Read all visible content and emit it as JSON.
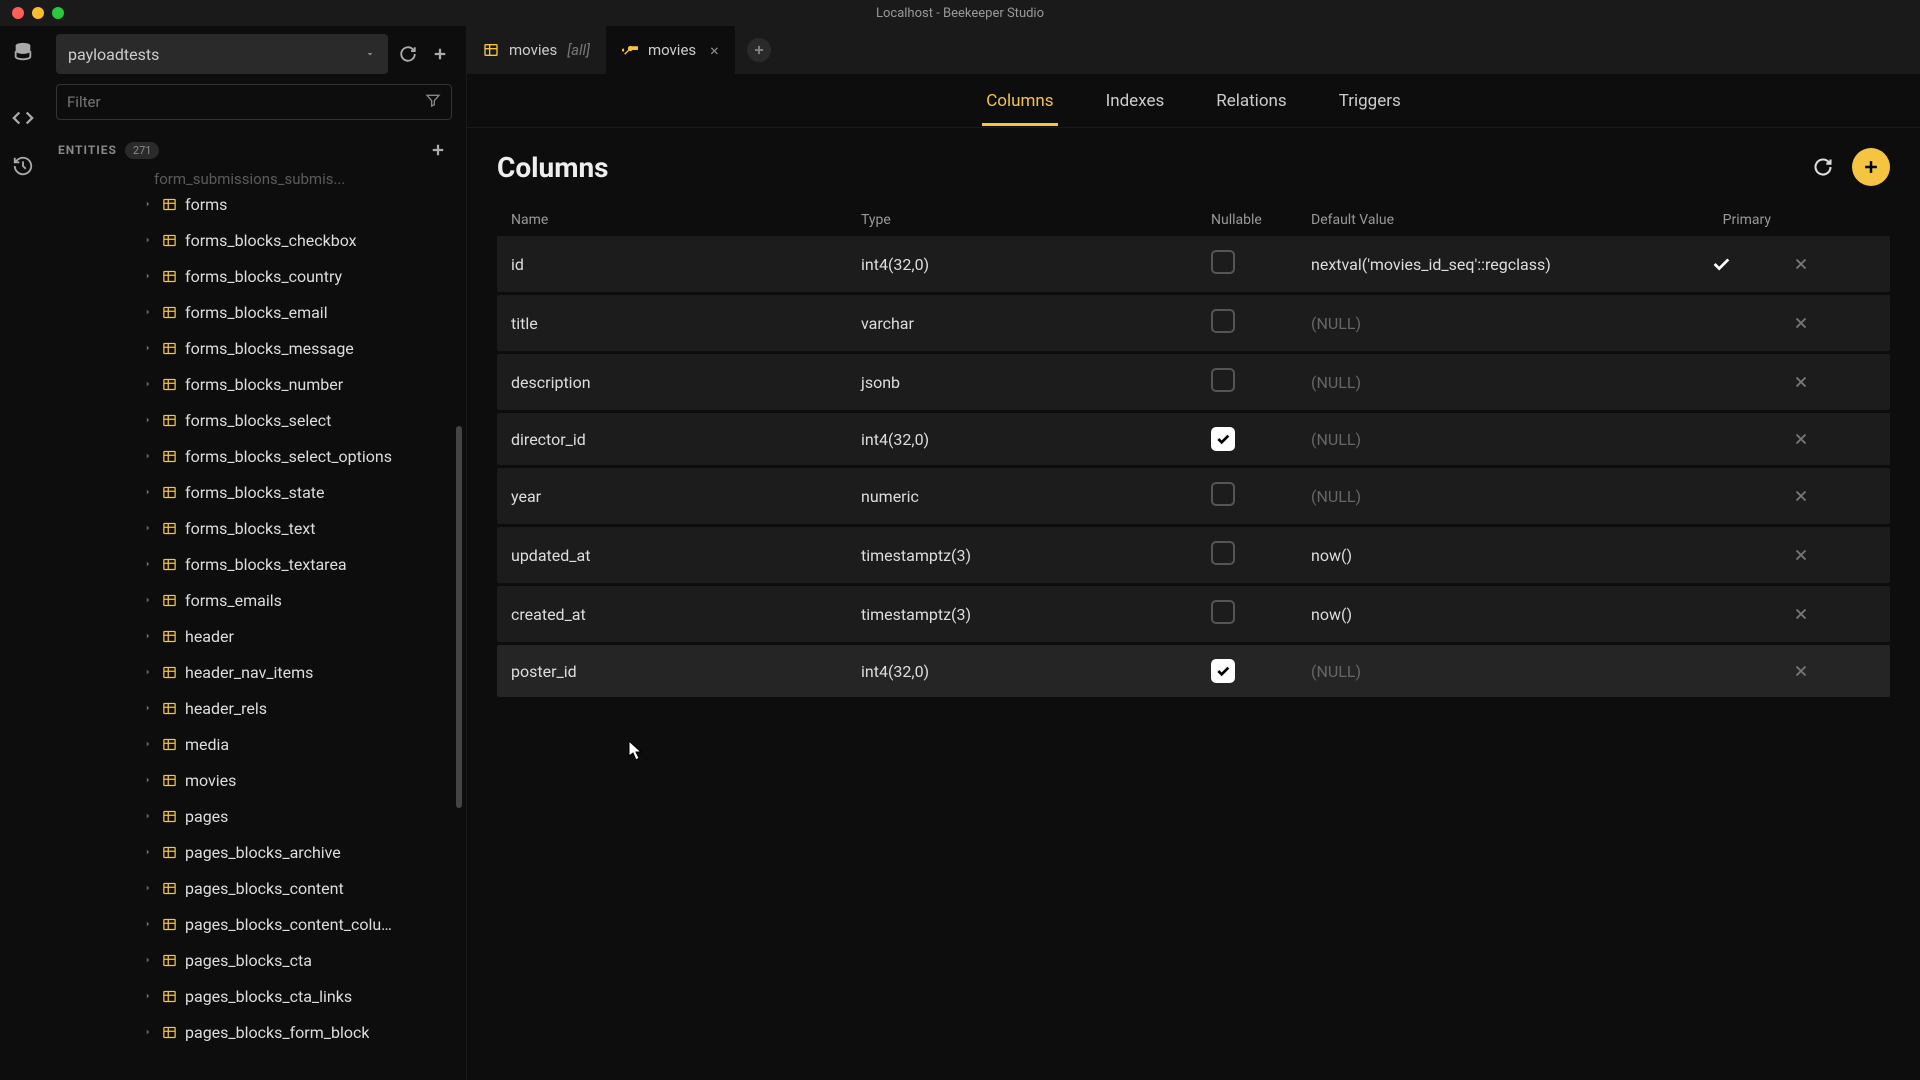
{
  "window": {
    "title": "Localhost - Beekeeper Studio"
  },
  "sidebar": {
    "db_name": "payloadtests",
    "filter_placeholder": "Filter",
    "entities_label": "ENTITIES",
    "entities_count": "271",
    "cutoff_item": "form_submissions_submis...",
    "items": [
      "forms",
      "forms_blocks_checkbox",
      "forms_blocks_country",
      "forms_blocks_email",
      "forms_blocks_message",
      "forms_blocks_number",
      "forms_blocks_select",
      "forms_blocks_select_options",
      "forms_blocks_state",
      "forms_blocks_text",
      "forms_blocks_textarea",
      "forms_emails",
      "header",
      "header_nav_items",
      "header_rels",
      "media",
      "movies",
      "pages",
      "pages_blocks_archive",
      "pages_blocks_content",
      "pages_blocks_content_colu…",
      "pages_blocks_cta",
      "pages_blocks_cta_links",
      "pages_blocks_form_block"
    ]
  },
  "tabs": [
    {
      "label": "movies",
      "suffix": "[all]",
      "icon": "table",
      "active": false
    },
    {
      "label": "movies",
      "suffix": "",
      "icon": "wrench",
      "active": true
    }
  ],
  "subnav": {
    "items": [
      "Columns",
      "Indexes",
      "Relations",
      "Triggers"
    ],
    "active": "Columns"
  },
  "columns_panel": {
    "title": "Columns",
    "headers": {
      "name": "Name",
      "type": "Type",
      "nullable": "Nullable",
      "default": "Default Value",
      "primary": "Primary"
    },
    "rows": [
      {
        "name": "id",
        "type": "int4(32,0)",
        "nullable": false,
        "default": "nextval('movies_id_seq'::regclass)",
        "default_null": false,
        "primary": true
      },
      {
        "name": "title",
        "type": "varchar",
        "nullable": false,
        "default": "(NULL)",
        "default_null": true,
        "primary": false
      },
      {
        "name": "description",
        "type": "jsonb",
        "nullable": false,
        "default": "(NULL)",
        "default_null": true,
        "primary": false
      },
      {
        "name": "director_id",
        "type": "int4(32,0)",
        "nullable": true,
        "default": "(NULL)",
        "default_null": true,
        "primary": false
      },
      {
        "name": "year",
        "type": "numeric",
        "nullable": false,
        "default": "(NULL)",
        "default_null": true,
        "primary": false
      },
      {
        "name": "updated_at",
        "type": "timestamptz(3)",
        "nullable": false,
        "default": "now()",
        "default_null": false,
        "primary": false
      },
      {
        "name": "created_at",
        "type": "timestamptz(3)",
        "nullable": false,
        "default": "now()",
        "default_null": false,
        "primary": false
      },
      {
        "name": "poster_id",
        "type": "int4(32,0)",
        "nullable": true,
        "default": "(NULL)",
        "default_null": true,
        "primary": false
      }
    ]
  }
}
